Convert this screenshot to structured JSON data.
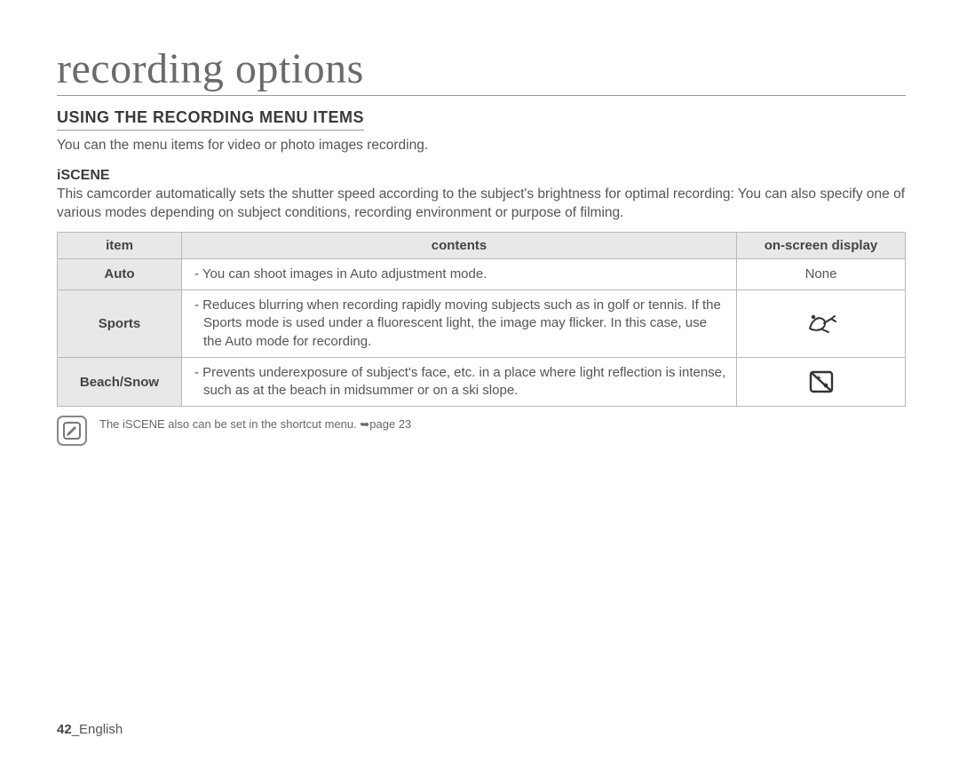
{
  "title": "recording options",
  "sectionHeading": "USING THE RECORDING MENU ITEMS",
  "intro": "You can the menu items for video or photo images recording.",
  "subheading": "iSCENE",
  "desc": "This camcorder automatically sets the shutter speed according to the subject's brightness for optimal recording: You can also specify one of various modes depending on subject conditions, recording environment or purpose of filming.",
  "table": {
    "headers": {
      "item": "item",
      "contents": "contents",
      "osd": "on-screen display"
    },
    "rows": [
      {
        "item": "Auto",
        "contents": "- You can shoot images in Auto adjustment mode.",
        "osd_text": "None",
        "osd_icon": null
      },
      {
        "item": "Sports",
        "contents": "- Reduces blurring when recording rapidly moving subjects such as in golf or tennis. If the Sports mode is used under a fluorescent light, the image may flicker. In this case, use the Auto mode for recording.",
        "osd_text": null,
        "osd_icon": "sports"
      },
      {
        "item": "Beach/Snow",
        "contents": "- Prevents underexposure of subject's face, etc. in a place where light reflection is intense, such as at the beach in midsummer or on a ski slope.",
        "osd_text": null,
        "osd_icon": "beach"
      }
    ]
  },
  "note": {
    "text": "The iSCENE also can be set in the shortcut menu. ",
    "pageref": "page 23"
  },
  "footer": {
    "pageNumber": "42",
    "separator": "_",
    "lang": "English"
  },
  "chart_data": {
    "type": "table",
    "title": "iSCENE recording modes",
    "columns": [
      "item",
      "contents",
      "on-screen display"
    ],
    "rows": [
      [
        "Auto",
        "You can shoot images in Auto adjustment mode.",
        "None"
      ],
      [
        "Sports",
        "Reduces blurring when recording rapidly moving subjects such as in golf or tennis. If the Sports mode is used under a fluorescent light, the image may flicker. In this case, use the Auto mode for recording.",
        "(sports icon)"
      ],
      [
        "Beach/Snow",
        "Prevents underexposure of subject's face, etc. in a place where light reflection is intense, such as at the beach in midsummer or on a ski slope.",
        "(beach/snow icon)"
      ]
    ]
  }
}
